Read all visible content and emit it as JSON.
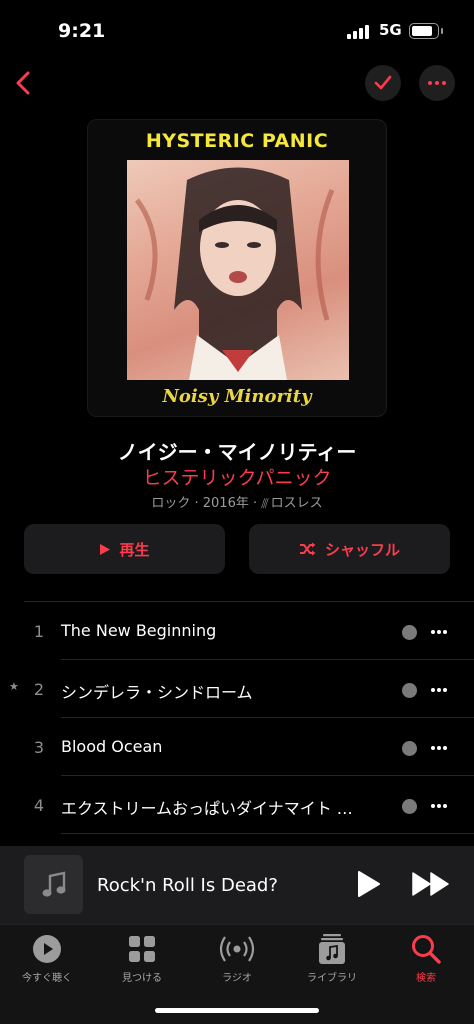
{
  "status_bar": {
    "time": "9:21",
    "network": "5G",
    "battery_level": 0.85
  },
  "nav": {
    "back_icon": "chevron-left-icon",
    "check_icon": "checkmark-icon",
    "more_icon": "ellipsis-icon"
  },
  "artwork": {
    "band_text": "HYSTERIC PANIC",
    "album_text": "Noisy Minority"
  },
  "album": {
    "title": "ノイジー・マイノリティー",
    "artist": "ヒステリックパニック",
    "meta": "ロック · 2016年 · ",
    "lossless": "ロスレス"
  },
  "actions": {
    "play_label": "再生",
    "shuffle_label": "シャッフル"
  },
  "tracks": [
    {
      "number": "1",
      "title": "The New Beginning",
      "starred": false
    },
    {
      "number": "2",
      "title": "シンデレラ・シンドローム",
      "starred": true,
      "star": "★"
    },
    {
      "number": "3",
      "title": "Blood Ocean",
      "starred": false
    },
    {
      "number": "4",
      "title": "エクストリームおっぱいダイナマイト …",
      "starred": false
    }
  ],
  "mini_player": {
    "title": "Rock'n Roll Is Dead?"
  },
  "tabs": [
    {
      "label": "今すぐ聴く",
      "icon": "play-circle-icon"
    },
    {
      "label": "見つける",
      "icon": "grid-icon"
    },
    {
      "label": "ラジオ",
      "icon": "radio-icon"
    },
    {
      "label": "ライブラリ",
      "icon": "library-icon"
    },
    {
      "label": "検索",
      "icon": "search-icon",
      "active": true
    }
  ],
  "colors": {
    "accent": "#fa3c4c",
    "background": "#000000",
    "surface": "#1c1c1e"
  }
}
